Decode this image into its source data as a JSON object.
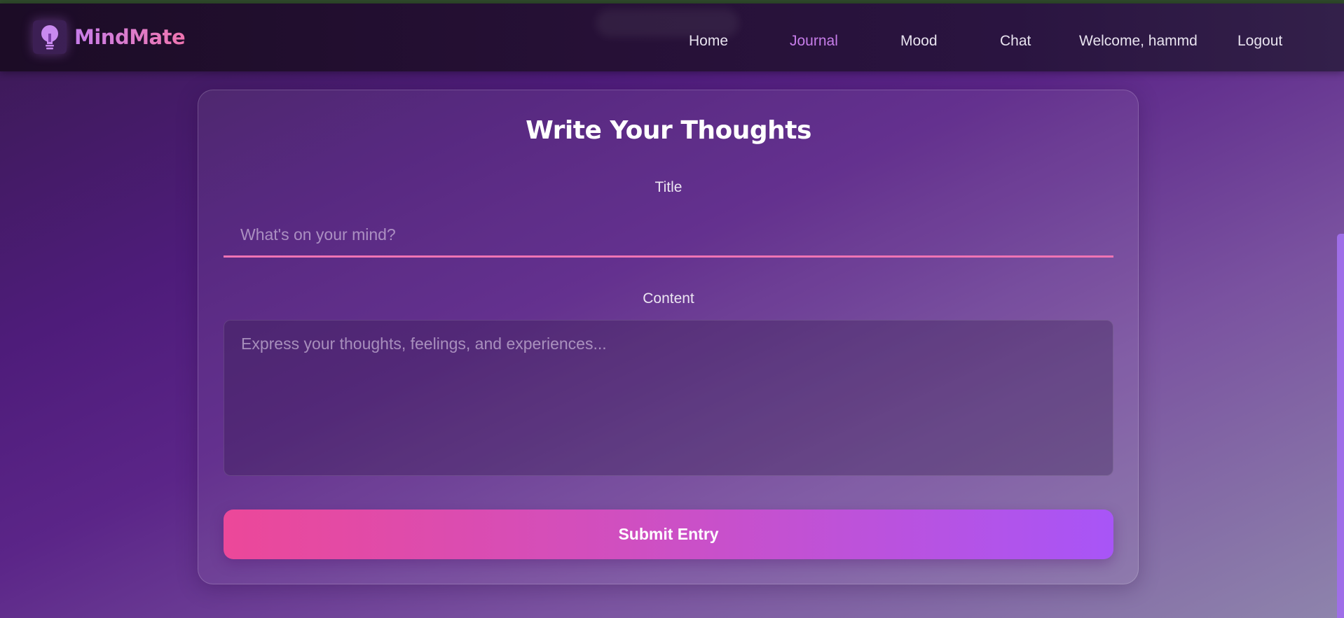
{
  "app": {
    "name": "MindMate",
    "logo_icon": "lightbulb-icon"
  },
  "nav": {
    "links": [
      {
        "label": "Home",
        "active": false
      },
      {
        "label": "Journal",
        "active": true
      },
      {
        "label": "Mood",
        "active": false
      },
      {
        "label": "Chat",
        "active": false
      }
    ],
    "welcome": "Welcome, hammd",
    "logout": "Logout"
  },
  "form": {
    "heading": "Write Your Thoughts",
    "title_label": "Title",
    "title_placeholder": "What's on your mind?",
    "title_value": "",
    "content_label": "Content",
    "content_placeholder": "Express your thoughts, feelings, and experiences...",
    "content_value": "",
    "submit_label": "Submit Entry"
  },
  "colors": {
    "accent_pink": "#ec4899",
    "accent_purple": "#a855f7",
    "active_link": "#c77dea",
    "input_underline": "#ef74b4"
  }
}
